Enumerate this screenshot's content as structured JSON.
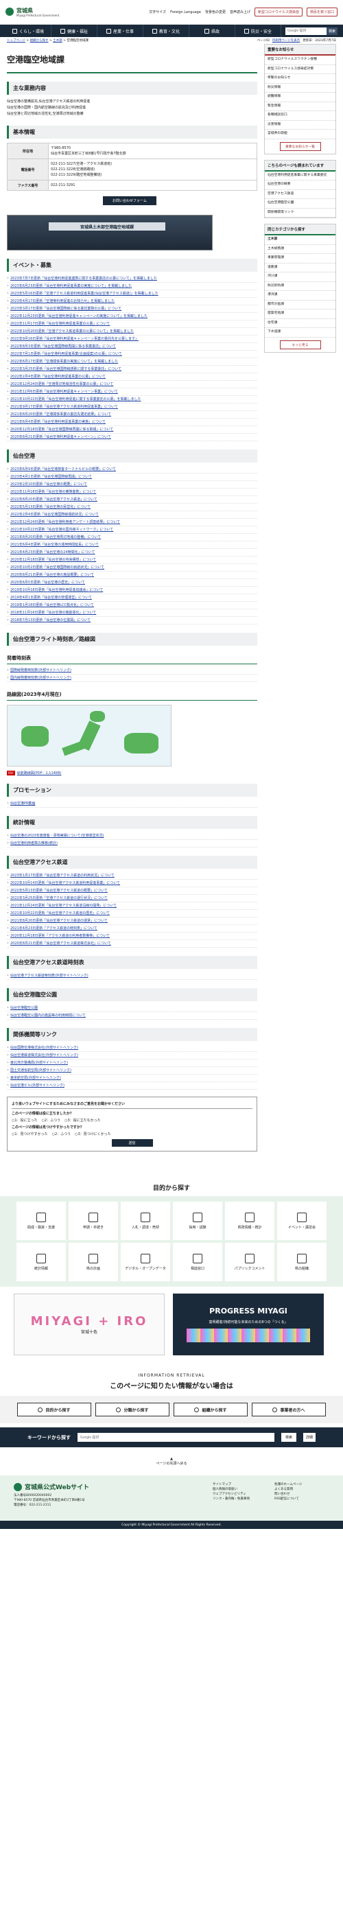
{
  "header": {
    "site_name": "宮城県",
    "site_sub": "Miyagi Prefectural Government",
    "links": [
      "文字サイズ",
      "Foreign Language",
      "背景色の変更",
      "音声読み上げ"
    ],
    "btn1": "新型コロナウイルス感染症",
    "btn2": "県民を救う窓口"
  },
  "nav": {
    "items": [
      "くらし・環境",
      "健康・福祉",
      "産業・仕事",
      "教育・文化",
      "県政",
      "防災・安全"
    ],
    "search_placeholder": "Google 提供",
    "search_btn": "検索"
  },
  "subbar": [
    "ページID",
    "印刷用ページを表示",
    "更新日：2023年7月7日"
  ],
  "breadcrumb": [
    "トップページ",
    "組織から探す",
    "土木部",
    "空港臨空地域課"
  ],
  "page": {
    "title": "空港臨空地域課"
  },
  "duties": {
    "heading": "主な業務内容",
    "lines": [
      "仙台空港の整備拡充,仙台空港アクセス鉄道の利用促進",
      "仙台空港の国際・国内航空路線の拡充及び利用促進",
      "仙台空港と周辺地域の活性化,空港周辺地域の整備"
    ]
  },
  "basic": {
    "heading": "基本情報",
    "rows": [
      {
        "k": "所在地",
        "v": "〒980-8570\n仙台市青葉区本町三丁目8番1号行政庁舎7階北側"
      },
      {
        "k": "電話番号",
        "v": "022-211-3227(空港・アクセス鉄道班)\n022-211-3228(空港航路班)\n022-211-3229(臨空地域整備班)"
      },
      {
        "k": "ファクス番号",
        "v": "022-211-3291"
      }
    ],
    "contact_btn": "お問い合わせフォーム"
  },
  "banner": {
    "text": "宮城県土木部空港臨空地域課"
  },
  "events": {
    "heading": "イベント・募集",
    "items": [
      "2023年7月7日更新「仙台空港利用促進連携に関する事業委託の公募について」を掲載しました",
      "2023年6月23日更新「仙台空港利用促進事業の実施について」を掲載しました",
      "2023年5月16日更新「空港アクセス鉄道利用促進事業(仙台空港アクセス鉄道)」を掲載しました",
      "2023年4月17日更新「空港等利用促進のお知らせ」を掲載しました",
      "2023年3月17日更新「仙台空港国際線に係る委託業務の公募」について",
      "2022年12月23日更新「仙台空港利用促進キャンペーンの実施について」を掲載しました",
      "2022年11月17日更新「仙台空港利用促進事業の公募」について",
      "2022年10月20日更新「空港アクセス鉄道事業の公募について」を掲載しました",
      "2022年9月16日更新「仙台空港利用促進キャンペーン事業の委託先を公募します」",
      "2022年8月3日更新「仙台空港国際線再開に係る事業委託」について",
      "2022年7月1日更新「仙台空港利用促進事業(企画提案)の公募」について",
      "2022年6月17日更新「空港関係事業の実施について」を掲載しました",
      "2022年3月25日更新「仙台空港国際線誘致に関する事業委託」について",
      "2022年2月4日更新「仙台空港利用促進事業の公募」について",
      "2021年12月24日更新「空港周辺地域活性化事業の公募」について",
      "2021年12月6日更新「仙台空港利用促進キャンペーン事業」について",
      "2021年10月22日更新「仙台空港利用促進に関する事業委託の公募」を掲載しました",
      "2021年9月17日更新「仙台空港アクセス鉄道利用促進事業」について",
      "2021年8月20日更新「空港関係事業の委託先選定結果」について",
      "2021年6月4日更新「仙台空港利用促進事業の実施」について",
      "2020年12月18日更新「仙台空港国際線再開に係る取組」について",
      "2020年8月21日更新「仙台空港利用促進キャンペーン」について"
    ]
  },
  "airport": {
    "heading": "仙台空港",
    "items": [
      "2023年6月9日更新「仙台空港旅客ターミナルビルの概要」について",
      "2023年4月1日更新「仙台空港国際線再開」について",
      "2023年2月10日更新「仙台空港の概要」について",
      "2022年11月18日更新「仙台空港の乗降客数」について",
      "2022年8月20日更新「仙台空港アクセス鉄道」について",
      "2022年5月13日更新「仙台空港の民営化」について",
      "2022年2月4日更新「仙台空港国際線運航状況」について",
      "2021年12月24日更新「仙台空港利用者アンケート調査結果」について",
      "2021年10月22日更新「仙台空港の国内線ネットワーク」について",
      "2021年8月20日更新「仙台空港周辺地域の整備」について",
      "2021年6月4日更新「仙台空港の運用時間延長」について",
      "2021年4月23日更新「仙台空港の24時間化」について",
      "2020年12月18日更新「仙台空港の将来構想」について",
      "2020年10月2日更新「仙台空港国際線の就航状況」について",
      "2020年8月21日更新「仙台空港の施設概要」について",
      "2020年6月5日更新「仙台空港の歴史」について",
      "2019年10月18日更新「仙台空港利用促進協議会」について",
      "2019年4月1日更新「仙台空港の管理運営」について",
      "2019年1月18日更新「仙台空港LCC拠点化」について",
      "2018年11月16日更新「仙台空港の機能強化」について",
      "2018年7月13日更新「仙台空港の位置図」について"
    ]
  },
  "flight": {
    "heading": "仙台空港フライト時刻表／路線図",
    "sub1": "発着時刻表",
    "timetable": [
      "国際線発着時刻表(外部サイトへリンク)",
      "国内線発着時刻表(外部サイトへリンク)"
    ],
    "sub2": "路線図(2023年4月現在)",
    "pdf_label": "PDF",
    "pdf_text": "就航路線図(PDF：1,114KB)"
  },
  "promo_sec": {
    "heading": "プロモーション",
    "items": [
      "仙台空港PR動画"
    ]
  },
  "stats": {
    "heading": "統計情報",
    "items": [
      "仙台空港の2023年度旅客・貨物実績について(空港運営状況)",
      "仙台空港利用者数の推移(統計)"
    ]
  },
  "rail": {
    "heading": "仙台空港アクセス鉄道",
    "items": [
      "2023年1月17日更新「仙台空港アクセス鉄道の利用状況」について",
      "2022年10月14日更新「仙台空港アクセス鉄道利用促進事業」について",
      "2022年5月13日更新「仙台空港アクセス鉄道の概要」について",
      "2022年3月25日更新「空港アクセス鉄道の運行状況」について",
      "2021年12月24日更新「仙台空港アクセス鉄道沿線の開発」について",
      "2021年10月22日更新「仙台空港アクセス鉄道の歴史」について",
      "2021年8月20日更新「仙台空港アクセス鉄道の運賃」について",
      "2021年4月23日更新「アクセス鉄道の時刻表」について",
      "2020年12月18日更新「アクセス鉄道の利用者数推移」について",
      "2020年8月21日更新「仙台空港アクセス鉄道株式会社」について"
    ]
  },
  "railtt": {
    "heading": "仙台空港アクセス鉄道時刻表",
    "items": [
      "仙台空港アクセス鉄道時刻表(外部サイトへリンク)"
    ]
  },
  "park": {
    "heading": "仙台空港臨空公園",
    "items": [
      "仙台空港臨空公園",
      "仙台空港臨空公園内の施設等の利用時間について"
    ]
  },
  "links_sec": {
    "heading": "関係機関等リンク",
    "items": [
      "仙台国際空港株式会社(外部サイトへリンク)",
      "仙台空港鉄道株式会社(外部サイトへリンク)",
      "東北地方整備局(外部サイトへリンク)",
      "国土交通省航空局(外部サイトへリンク)",
      "東京航空局(外部サイトへリンク)",
      "仙台空港ビル(外部サイトへリンク)"
    ]
  },
  "survey": {
    "title": "より良いウェブサイトにするためにみなさまのご意見をお聞かせください",
    "q1": "このページの情報は役に立ちましたか？",
    "q1opts": [
      "1：役に立った",
      "2：ふつう",
      "3：役に立たなかった"
    ],
    "q2": "このページの情報は見つけやすかったですか？",
    "q2opts": [
      "1：見つけやすかった",
      "2：ふつう",
      "3：見つけにくかった"
    ],
    "submit": "送信"
  },
  "side": {
    "notice_h": "重要なお知らせ",
    "notices": [
      "新型コロナウイルスワクチン接種",
      "新型コロナウイルス感染症対策",
      "県警のお知らせ",
      "防災情報",
      "避難情報",
      "緊急情報",
      "各種相談窓口",
      "災害情報",
      "宮城県の取組"
    ],
    "notice_btn": "重要なお知らせ一覧",
    "read_h": "こちらのページも読まれています",
    "reads": [
      "仙台空港利用促進事業に関する事業委託",
      "仙台空港の概要",
      "空港アクセス鉄道",
      "仙台空港臨空公園",
      "関係機関等リンク"
    ],
    "dept_h": "同じカテゴリから探す",
    "dept_name": "土木部",
    "depts": [
      "土木総務課",
      "事業管理課",
      "道路課",
      "河川課",
      "防災砂防課",
      "港湾課",
      "都市計画課",
      "建築宅地課",
      "住宅課",
      "下水道課"
    ],
    "dept_btn": "もっと見る"
  },
  "purpose": {
    "heading": "目的から探す",
    "items": [
      "助成・融資・支援",
      "申請・手続き",
      "入札・調達・売却",
      "採用・試験",
      "県政情報・統計",
      "イベント・講習会",
      "統計情報",
      "県の計画",
      "デジタル・オープンデータ",
      "相談窓口",
      "パブリックコメント",
      "県の組織"
    ]
  },
  "promo": {
    "p1a": "MIYAGI",
    "p1b": "IRO",
    "p1c": "宮城十色",
    "p2a": "PROGRESS MIYAGI",
    "p2b": "富県躍進!持続可能な未来のための8つの「つくる」"
  },
  "retrieval": {
    "a": "INFORMATION RETRIEVAL",
    "b": "このページに知りたい情報がない場合は",
    "btns": [
      "目的から探す",
      "分類から探す",
      "組織から探す",
      "事業者の方へ"
    ]
  },
  "kw": {
    "label": "キーワードから探す",
    "placeholder": "Google 提供",
    "btn": "検索",
    "dd": "詳細"
  },
  "totop": "ページの先頭へ戻る",
  "footer": {
    "name": "宮城県公式Webサイト",
    "code": "法人番号8000020040002",
    "addr1": "〒980-8570 宮城県仙台市青葉区本町3丁目8番1号",
    "addr2": "電話番号：022-211-2111",
    "links": [
      "サイトマップ",
      "個人情報の取扱い",
      "ウェブアクセシビリティ",
      "リンク・著作権・免責事項",
      "各課のホームページ",
      "よくある質問",
      "問い合わせ",
      "RSS配信について"
    ]
  },
  "copyright": "Copyright © Miyagi Prefectural Government All Rights Reserved."
}
